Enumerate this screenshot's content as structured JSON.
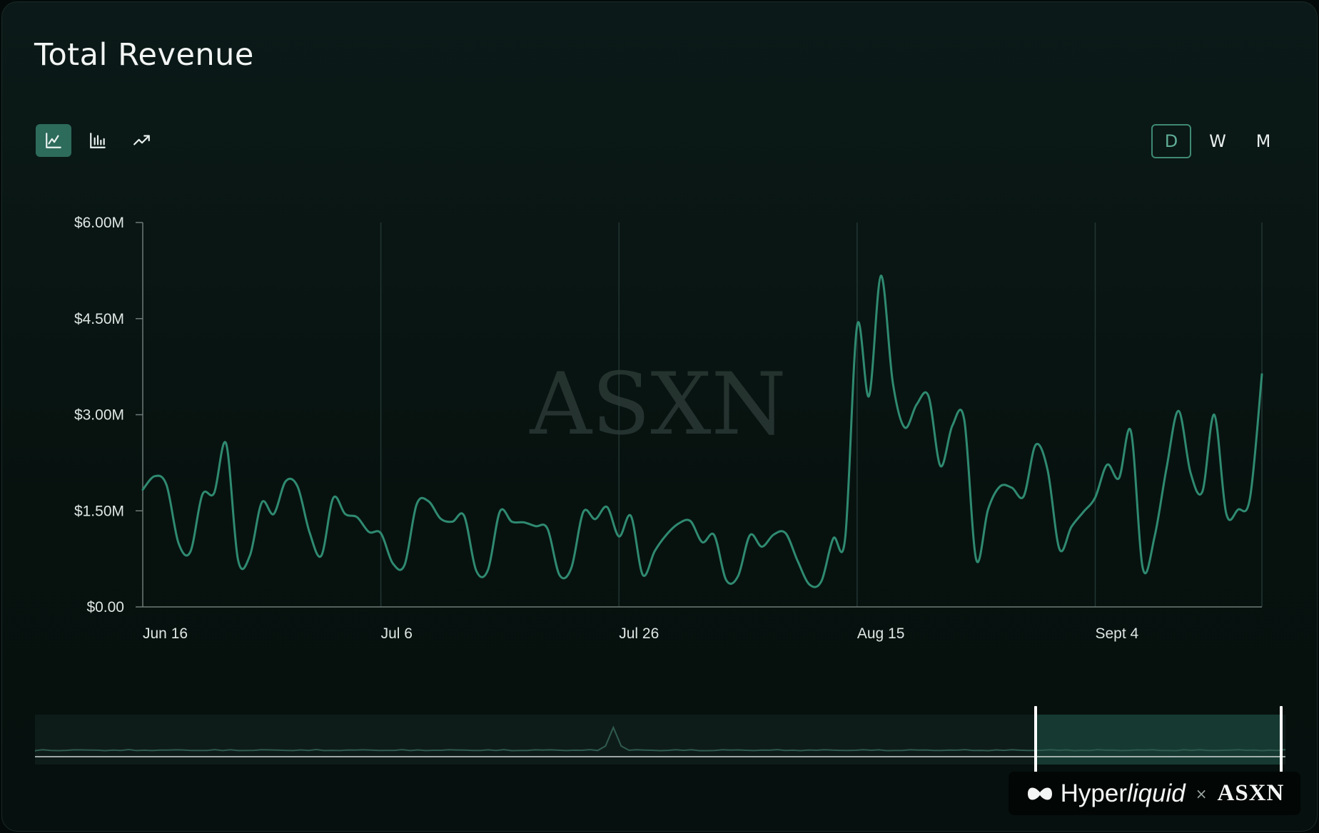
{
  "header": {
    "title": "Total Revenue"
  },
  "toolbar": {
    "chart_types": [
      {
        "name": "line-chart",
        "icon": "line-chart-icon",
        "active": true
      },
      {
        "name": "bar-chart",
        "icon": "bar-chart-icon",
        "active": false
      },
      {
        "name": "trend",
        "icon": "trend-up-icon",
        "active": false
      }
    ],
    "periods": [
      {
        "label": "D",
        "active": true
      },
      {
        "label": "W",
        "active": false
      },
      {
        "label": "M",
        "active": false
      }
    ]
  },
  "colors": {
    "line": "#2f8a70",
    "accent": "#2d6b5b",
    "background": "#0a1816",
    "grid": "#223532"
  },
  "watermark": "ASXN",
  "navigator": {
    "selected_range": [
      0.8,
      1.0
    ]
  },
  "brand": {
    "hyper": "Hyper",
    "liquid": "liquid",
    "x": "×",
    "asxn": "ASXN"
  },
  "chart_data": {
    "type": "line",
    "title": "Total Revenue",
    "xlabel": "",
    "ylabel": "",
    "x_ticks": [
      {
        "label": "Jun 16",
        "day": 0
      },
      {
        "label": "Jul 6",
        "day": 20
      },
      {
        "label": "Jul 26",
        "day": 40
      },
      {
        "label": "Aug 15",
        "day": 60
      },
      {
        "label": "Sept 4",
        "day": 80
      }
    ],
    "y_ticks": [
      "$0.00",
      "$1.50M",
      "$3.00M",
      "$4.50M",
      "$6.00M"
    ],
    "ylim": [
      0,
      6000000
    ],
    "xlim": [
      "Jun 16",
      "Sep 11"
    ],
    "grid": "vertical",
    "series": [
      {
        "dates": [
          "Jun 16",
          "Jun 17",
          "Jun 18",
          "Jun 19",
          "Jun 20",
          "Jun 21",
          "Jun 22",
          "Jun 23",
          "Jun 24",
          "Jun 25",
          "Jun 26",
          "Jun 27",
          "Jun 28",
          "Jun 29",
          "Jun 30",
          "Jul 1",
          "Jul 2",
          "Jul 3",
          "Jul 4",
          "Jul 5",
          "Jul 6",
          "Jul 7",
          "Jul 8",
          "Jul 9",
          "Jul 10",
          "Jul 11",
          "Jul 12",
          "Jul 13",
          "Jul 14",
          "Jul 15",
          "Jul 16",
          "Jul 17",
          "Jul 18",
          "Jul 19",
          "Jul 20",
          "Jul 21",
          "Jul 22",
          "Jul 23",
          "Jul 24",
          "Jul 25",
          "Jul 26",
          "Jul 27",
          "Jul 28",
          "Jul 29",
          "Jul 30",
          "Jul 31",
          "Aug 1",
          "Aug 2",
          "Aug 3",
          "Aug 4",
          "Aug 5",
          "Aug 6",
          "Aug 7",
          "Aug 8",
          "Aug 9",
          "Aug 10",
          "Aug 11",
          "Aug 12",
          "Aug 13",
          "Aug 14",
          "Aug 15",
          "Aug 16",
          "Aug 17",
          "Aug 18",
          "Aug 19",
          "Aug 20",
          "Aug 21",
          "Aug 22",
          "Aug 23",
          "Aug 24",
          "Aug 25",
          "Aug 26",
          "Aug 27",
          "Aug 28",
          "Aug 29",
          "Aug 30",
          "Aug 31",
          "Sep 1",
          "Sep 2",
          "Sep 3",
          "Sep 4",
          "Sep 5",
          "Sep 6",
          "Sep 7",
          "Sep 8",
          "Sep 9",
          "Sep 10",
          "Sep 11"
        ],
        "values": [
          1830000,
          2040000,
          1900000,
          1000000,
          860000,
          1750000,
          1780000,
          2550000,
          740000,
          800000,
          1630000,
          1450000,
          1960000,
          1880000,
          1170000,
          800000,
          1700000,
          1450000,
          1400000,
          1170000,
          1150000,
          680000,
          660000,
          1600000,
          1650000,
          1380000,
          1330000,
          1420000,
          570000,
          580000,
          1490000,
          1330000,
          1320000,
          1260000,
          1220000,
          500000,
          610000,
          1480000,
          1370000,
          1560000,
          1100000,
          1420000,
          500000,
          870000,
          1130000,
          1300000,
          1340000,
          1010000,
          1120000,
          420000,
          480000,
          1120000,
          940000,
          1130000,
          1150000,
          720000,
          350000,
          400000,
          1070000,
          1080000,
          4390000,
          3290000,
          5170000,
          3500000,
          2800000,
          3160000,
          3290000,
          2200000,
          2830000,
          2920000,
          740000,
          1520000,
          1880000,
          1860000,
          1730000,
          2530000,
          2140000,
          900000,
          1250000,
          1480000,
          1710000,
          2220000,
          2010000,
          2740000,
          600000,
          1110000,
          2180000,
          3060000,
          2100000,
          1800000,
          3000000,
          1460000,
          1520000,
          1700000,
          3630000
        ]
      }
    ]
  }
}
